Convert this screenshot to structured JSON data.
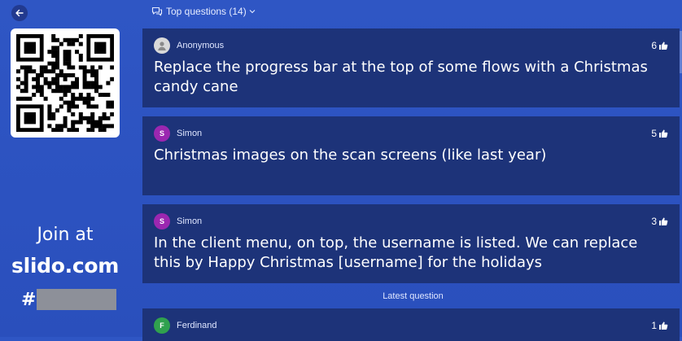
{
  "nav": {
    "back_icon": "arrow-left-icon"
  },
  "join": {
    "label": "Join at",
    "url": "slido.com",
    "code_prefix": "#",
    "code_redacted": true
  },
  "header": {
    "label": "Top questions (14)",
    "icon": "chat-bubbles-icon",
    "dropdown_icon": "chevron-down-icon"
  },
  "questions": [
    {
      "author": "Anonymous",
      "avatar": "",
      "avatar_color": "#d9d9d9",
      "votes": "6",
      "text": "Replace the progress bar at the top of some flows with a Christmas candy cane"
    },
    {
      "author": "Simon",
      "avatar": "S",
      "avatar_color": "#9b27b0",
      "votes": "5",
      "text": "Christmas images on the scan screens (like last year)"
    },
    {
      "author": "Simon",
      "avatar": "S",
      "avatar_color": "#9b27b0",
      "votes": "3",
      "text": "In the client menu, on top, the username is listed. We can replace this by Happy Christmas [username] for the holidays"
    }
  ],
  "latest": {
    "label": "Latest question",
    "author": "Ferdinand",
    "avatar": "F",
    "avatar_color": "#30a14e",
    "votes": "1"
  },
  "colors": {
    "background": "#2f56c4",
    "card": "#1d3379"
  }
}
